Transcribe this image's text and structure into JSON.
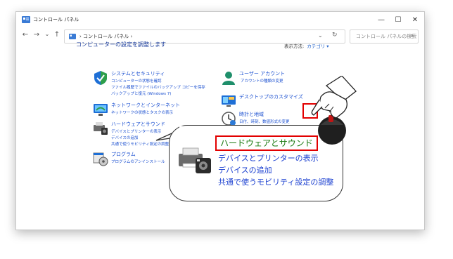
{
  "window": {
    "title": "コントロール パネル",
    "controls": {
      "minimize": "—",
      "maximize": "☐",
      "close": "✕"
    }
  },
  "nav": {
    "back": "←",
    "forward": "→",
    "dropdown": "⌄",
    "up": "↑",
    "breadcrumb": "› コントロール パネル ›",
    "address_chevron": "⌄",
    "refresh": "↻",
    "search_placeholder": "コントロール パネルの検索",
    "search_icon": "⌕"
  },
  "page": {
    "title": "コンピューターの設定を調整します",
    "view_by_label": "表示方法:",
    "view_by_value": "カテゴリ ▾"
  },
  "categories": {
    "system": {
      "title": "システムとセキュリティ",
      "links": [
        "コンピューターの状態を確認",
        "ファイル履歴でファイルのバックアップ コピーを保存",
        "バックアップと復元 (Windows 7)"
      ]
    },
    "network": {
      "title": "ネットワークとインターネット",
      "links": [
        "ネットワークの状態とタスクの表示"
      ]
    },
    "hardware": {
      "title": "ハードウェアとサウンド",
      "links": [
        "デバイスとプリンターの表示",
        "デバイスの追加",
        "共通で使うモビリティ設定の調整"
      ]
    },
    "programs": {
      "title": "プログラム",
      "links": [
        "プログラムのアンインストール"
      ]
    },
    "user": {
      "title": "ユーザー アカウント",
      "links": [
        "アカウントの種類の変更"
      ]
    },
    "appearance": {
      "title": "デスクトップのカスタマイズ",
      "links": []
    },
    "clock": {
      "title": "時計と地域",
      "links": [
        "日付、時刻、数値形式の変更"
      ]
    }
  },
  "callout": {
    "title": "ハードウェアとサウンド",
    "links": [
      "デバイスとプリンターの表示",
      "デバイスの追加",
      "共通で使うモビリティ設定の調整"
    ]
  },
  "colors": {
    "link": "#1a4fd0",
    "highlight": "#e20000",
    "callout_title": "#1a7a10"
  }
}
